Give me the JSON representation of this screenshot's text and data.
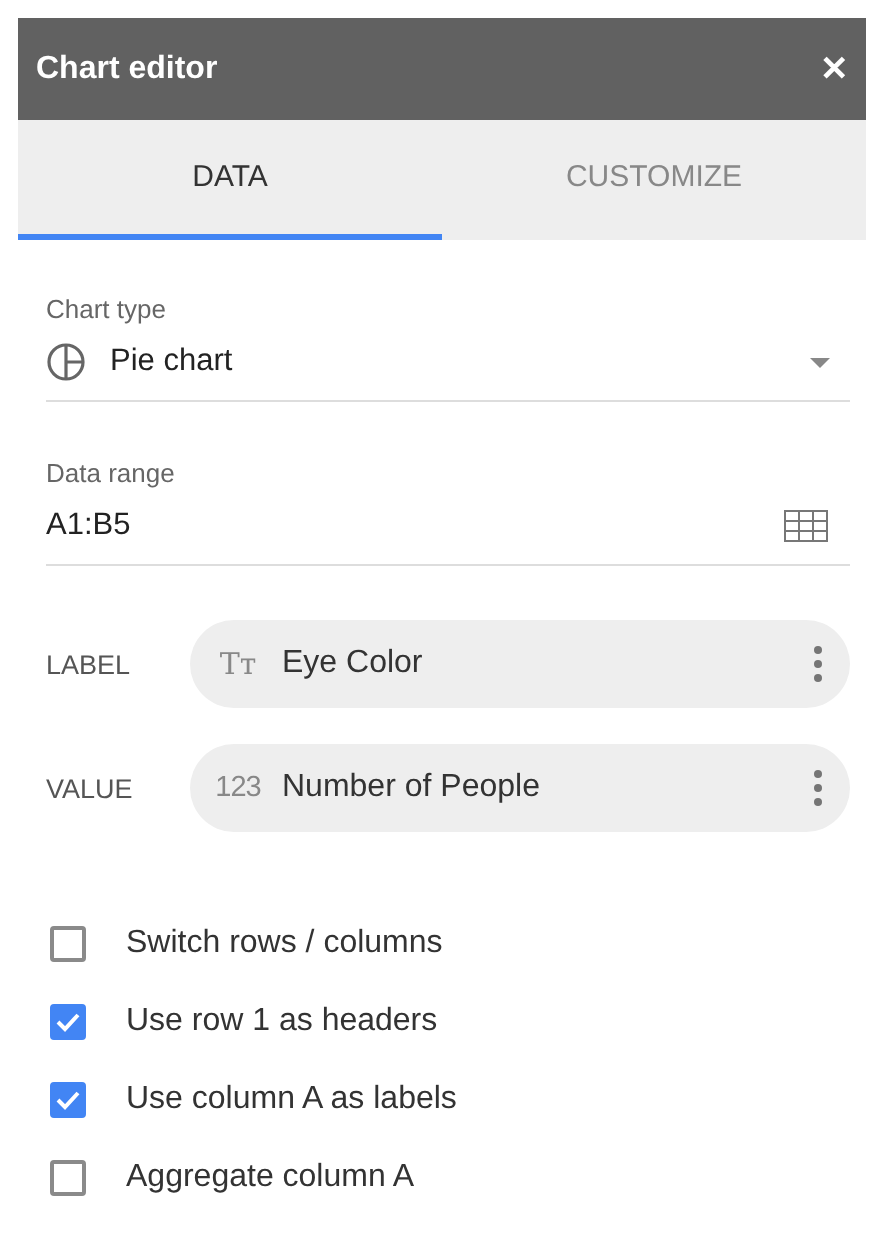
{
  "window": {
    "title": "Chart editor",
    "close": "✕"
  },
  "tabs": [
    {
      "label": "DATA",
      "selected": true
    },
    {
      "label": "CUSTOMIZE",
      "selected": false
    }
  ],
  "chart_type": {
    "label": "Chart type",
    "value": "Pie chart"
  },
  "data_range": {
    "label": "Data range",
    "value": "A1:B5"
  },
  "series": [
    {
      "role": "LABEL",
      "kind": "text",
      "glyph": "Tт",
      "name": "Eye Color"
    },
    {
      "role": "VALUE",
      "kind": "number",
      "glyph": "123",
      "name": "Number of People"
    }
  ],
  "options": [
    {
      "label": "Switch rows / columns",
      "checked": false
    },
    {
      "label": "Use row 1 as headers",
      "checked": true
    },
    {
      "label": "Use column A as labels",
      "checked": true
    },
    {
      "label": "Aggregate column A",
      "checked": false
    }
  ]
}
